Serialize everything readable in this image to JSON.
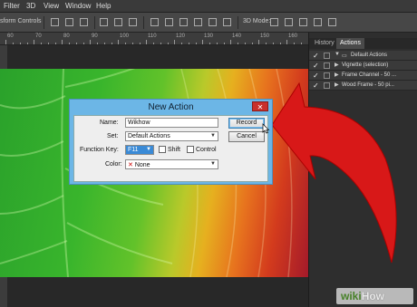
{
  "menu": [
    "Filter",
    "3D",
    "View",
    "Window",
    "Help"
  ],
  "options_bar": {
    "label": "sform Controls",
    "mode_label": "3D Mode:"
  },
  "ruler_numbers": [
    "60",
    "70",
    "80",
    "90",
    "100",
    "110",
    "120",
    "130",
    "140",
    "150",
    "160"
  ],
  "panel": {
    "tabs": [
      "History",
      "Actions"
    ],
    "rows": [
      {
        "label": "Default Actions",
        "checked": true
      },
      {
        "label": "Vignette (selection)",
        "checked": true
      },
      {
        "label": "Frame Channel - 50 ...",
        "checked": true
      },
      {
        "label": "Wood Frame - 50 pi...",
        "checked": true
      }
    ]
  },
  "dialog": {
    "title": "New Action",
    "close": "✕",
    "name_label": "Name:",
    "name_value": "Wikhow",
    "set_label": "Set:",
    "set_value": "Default Actions",
    "fkey_label": "Function Key:",
    "fkey_value": "F11",
    "shift_label": "Shift",
    "control_label": "Control",
    "color_label": "Color:",
    "color_value": "None",
    "color_icon": "✕",
    "record_label": "Record",
    "cancel_label": "Cancel"
  },
  "watermark": {
    "wiki": "wiki",
    "how": "How"
  },
  "colors": {
    "arrow": "#d81818",
    "dialog_frame": "#6cb6e6",
    "close_button": "#c9302c"
  }
}
